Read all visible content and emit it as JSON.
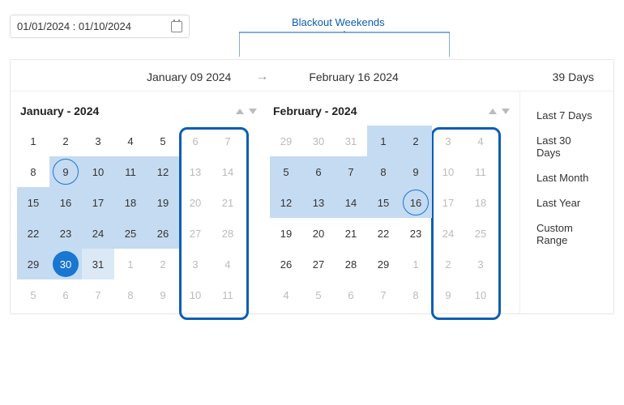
{
  "callout_label": "Blackout Weekends",
  "date_input": {
    "value": "01/01/2024 : 01/10/2024"
  },
  "range_header": {
    "start": "January 09 2024",
    "arrow": "→",
    "end": "February 16 2024",
    "days": "39 Days"
  },
  "presets": [
    "Last 7 Days",
    "Last 30 Days",
    "Last Month",
    "Last Year",
    "Custom Range"
  ],
  "months": [
    {
      "title": "January - 2024",
      "weeks": [
        [
          {
            "n": "1"
          },
          {
            "n": "2"
          },
          {
            "n": "3"
          },
          {
            "n": "4"
          },
          {
            "n": "5"
          },
          {
            "n": "6",
            "bo": true
          },
          {
            "n": "7",
            "bo": true
          }
        ],
        [
          {
            "n": "8"
          },
          {
            "n": "9",
            "r": true,
            "co": true
          },
          {
            "n": "10",
            "r": true
          },
          {
            "n": "11",
            "r": true
          },
          {
            "n": "12",
            "r": true
          },
          {
            "n": "13",
            "bo": true
          },
          {
            "n": "14",
            "bo": true
          }
        ],
        [
          {
            "n": "15",
            "r": true
          },
          {
            "n": "16",
            "r": true
          },
          {
            "n": "17",
            "r": true
          },
          {
            "n": "18",
            "r": true
          },
          {
            "n": "19",
            "r": true
          },
          {
            "n": "20",
            "bo": true
          },
          {
            "n": "21",
            "bo": true
          }
        ],
        [
          {
            "n": "22",
            "r": true
          },
          {
            "n": "23",
            "r": true
          },
          {
            "n": "24",
            "r": true
          },
          {
            "n": "25",
            "r": true
          },
          {
            "n": "26",
            "r": true
          },
          {
            "n": "27",
            "bo": true
          },
          {
            "n": "28",
            "bo": true
          }
        ],
        [
          {
            "n": "29",
            "r": true
          },
          {
            "n": "30",
            "r": true,
            "cf": true
          },
          {
            "n": "31",
            "rl": true
          },
          {
            "n": "1",
            "o": true
          },
          {
            "n": "2",
            "o": true
          },
          {
            "n": "3",
            "o": true,
            "bo": true
          },
          {
            "n": "4",
            "o": true,
            "bo": true
          }
        ],
        [
          {
            "n": "5",
            "o": true
          },
          {
            "n": "6",
            "o": true
          },
          {
            "n": "7",
            "o": true
          },
          {
            "n": "8",
            "o": true
          },
          {
            "n": "9",
            "o": true
          },
          {
            "n": "10",
            "o": true,
            "bo": true
          },
          {
            "n": "11",
            "o": true,
            "bo": true
          }
        ]
      ]
    },
    {
      "title": "February - 2024",
      "weeks": [
        [
          {
            "n": "29",
            "o": true
          },
          {
            "n": "30",
            "o": true
          },
          {
            "n": "31",
            "o": true
          },
          {
            "n": "1",
            "r": true
          },
          {
            "n": "2",
            "r": true
          },
          {
            "n": "3",
            "bo": true
          },
          {
            "n": "4",
            "bo": true
          }
        ],
        [
          {
            "n": "5",
            "r": true
          },
          {
            "n": "6",
            "r": true
          },
          {
            "n": "7",
            "r": true
          },
          {
            "n": "8",
            "r": true
          },
          {
            "n": "9",
            "r": true
          },
          {
            "n": "10",
            "bo": true
          },
          {
            "n": "11",
            "bo": true
          }
        ],
        [
          {
            "n": "12",
            "r": true
          },
          {
            "n": "13",
            "r": true
          },
          {
            "n": "14",
            "r": true
          },
          {
            "n": "15",
            "r": true
          },
          {
            "n": "16",
            "r": true,
            "co": true
          },
          {
            "n": "17",
            "bo": true
          },
          {
            "n": "18",
            "bo": true
          }
        ],
        [
          {
            "n": "19"
          },
          {
            "n": "20"
          },
          {
            "n": "21"
          },
          {
            "n": "22"
          },
          {
            "n": "23"
          },
          {
            "n": "24",
            "bo": true
          },
          {
            "n": "25",
            "bo": true
          }
        ],
        [
          {
            "n": "26"
          },
          {
            "n": "27"
          },
          {
            "n": "28"
          },
          {
            "n": "29"
          },
          {
            "n": "1",
            "o": true
          },
          {
            "n": "2",
            "o": true,
            "bo": true
          },
          {
            "n": "3",
            "o": true,
            "bo": true
          }
        ],
        [
          {
            "n": "4",
            "o": true
          },
          {
            "n": "5",
            "o": true
          },
          {
            "n": "6",
            "o": true
          },
          {
            "n": "7",
            "o": true
          },
          {
            "n": "8",
            "o": true
          },
          {
            "n": "9",
            "o": true,
            "bo": true
          },
          {
            "n": "10",
            "o": true,
            "bo": true
          }
        ]
      ]
    }
  ]
}
